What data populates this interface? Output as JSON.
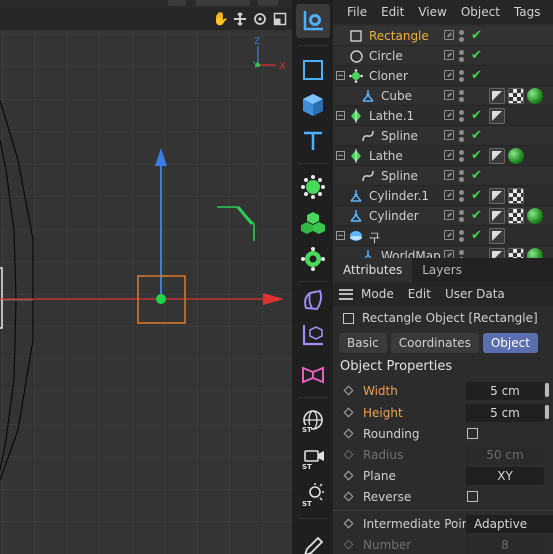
{
  "object_manager": {
    "menu": [
      "File",
      "Edit",
      "View",
      "Object",
      "Tags",
      "B"
    ],
    "rows": [
      {
        "name": "Rectangle",
        "icon": "rectangle-spline-icon",
        "active": true,
        "tags": []
      },
      {
        "name": "Circle",
        "icon": "circle-spline-icon",
        "active": false,
        "tags": []
      },
      {
        "name": "Cloner",
        "icon": "cloner-icon",
        "active": false,
        "tags": []
      },
      {
        "name": "Cube",
        "icon": "cube-object-icon",
        "active": false,
        "tags": [
          "phong",
          "uv",
          "material"
        ]
      },
      {
        "name": "Lathe.1",
        "icon": "lathe-icon",
        "active": false,
        "tags": [
          "phong"
        ]
      },
      {
        "name": "Spline",
        "icon": "spline-icon",
        "active": false,
        "tags": []
      },
      {
        "name": "Lathe",
        "icon": "lathe-icon",
        "active": false,
        "tags": [
          "phong",
          "material"
        ]
      },
      {
        "name": "Spline",
        "icon": "spline-icon",
        "active": false,
        "tags": []
      },
      {
        "name": "Cylinder.1",
        "icon": "cylinder-object-icon",
        "active": false,
        "tags": [
          "phong",
          "uv"
        ]
      },
      {
        "name": "Cylinder",
        "icon": "cylinder-object-icon",
        "active": false,
        "tags": [
          "phong",
          "uv",
          "material"
        ]
      },
      {
        "name": "구",
        "icon": "sphere-object-icon",
        "active": false,
        "tags": [
          "phong"
        ]
      },
      {
        "name": "WorldMap",
        "icon": "object-icon",
        "active": false,
        "tags": [
          "phong",
          "uv",
          "material"
        ]
      }
    ]
  },
  "attributes": {
    "tabs": [
      "Attributes",
      "Layers"
    ],
    "menu": [
      "Mode",
      "Edit",
      "User Data"
    ],
    "object_title": "Rectangle Object [Rectangle]",
    "subtabs": [
      "Basic",
      "Coordinates",
      "Object"
    ],
    "section": "Object Properties",
    "props": {
      "width": {
        "label": "Width",
        "value": "5 cm"
      },
      "height": {
        "label": "Height",
        "value": "5 cm"
      },
      "rounding": {
        "label": "Rounding"
      },
      "radius": {
        "label": "Radius",
        "value": "50 cm"
      },
      "plane": {
        "label": "Plane",
        "value": "XY"
      },
      "reverse": {
        "label": "Reverse"
      },
      "intermediate": {
        "label": "Intermediate Points",
        "value": "Adaptive"
      },
      "number": {
        "label": "Number",
        "value": "8"
      }
    }
  },
  "viewport": {
    "axis_labels": {
      "z": "Z",
      "y": "Y",
      "x": "X"
    },
    "colors": {
      "x_axis": "#e03030",
      "y_axis": "#3a7ee0",
      "selection": "#e07a2a",
      "grid": "#3d3d3d",
      "background": "#343434"
    }
  },
  "toolbar": {
    "icons": [
      "move-tool-icon",
      "rectangle-spline-icon",
      "cube-object-icon",
      "text-spline-icon",
      "cloner-icon",
      "cubes-object-icon",
      "gear-icon",
      "deformer-icon",
      "coordinate-axis-icon",
      "bend-deformer-icon",
      "globe-icon",
      "camera-icon",
      "light-icon",
      "pen-icon"
    ]
  }
}
